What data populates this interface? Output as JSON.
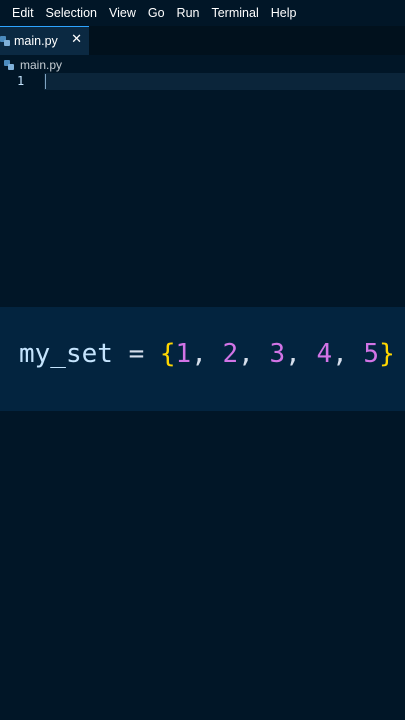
{
  "menubar": {
    "items": [
      "Edit",
      "Selection",
      "View",
      "Go",
      "Run",
      "Terminal",
      "Help"
    ]
  },
  "tabs": [
    {
      "label": "main.py",
      "icon": "python-file-icon",
      "active": true,
      "close": "✕"
    }
  ],
  "breadcrumb": {
    "file": "main.py",
    "icon": "python-file-icon"
  },
  "editor": {
    "line_numbers": [
      "1"
    ]
  },
  "code_banner": {
    "variable": "my_set",
    "operator": "=",
    "open_brace": "{",
    "numbers": [
      "1",
      "2",
      "3",
      "4",
      "5"
    ],
    "separator": ",",
    "close_brace": "}"
  },
  "colors": {
    "background": "#011627",
    "tab_active": "#0b2942",
    "banner": "#03243f",
    "variable": "#c5e4fd",
    "brace": "#ffd700",
    "number": "#d274e6"
  }
}
